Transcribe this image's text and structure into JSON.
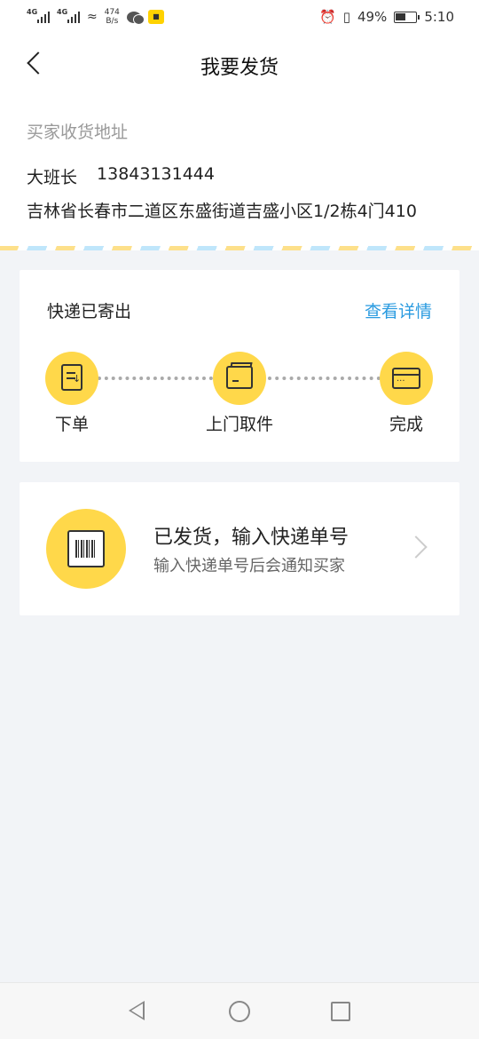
{
  "status_bar": {
    "signal1_label": "4G",
    "signal2_label": "4G",
    "net_speed_value": "474",
    "net_speed_unit": "B/s",
    "battery": "49%",
    "time": "5:10"
  },
  "header": {
    "title": "我要发货"
  },
  "address": {
    "label": "买家收货地址",
    "name": "大班长",
    "phone": "13843131444",
    "detail": "吉林省长春市二道区东盛街道吉盛小区1/2栋4门410"
  },
  "express": {
    "title": "快递已寄出",
    "detail_link": "查看详情",
    "steps": [
      {
        "label": "下单",
        "icon": "order-doc-icon"
      },
      {
        "label": "上门取件",
        "icon": "pickup-box-icon"
      },
      {
        "label": "完成",
        "icon": "complete-card-icon"
      }
    ]
  },
  "shipping": {
    "title": "已发货，输入快递单号",
    "subtitle": "输入快递单号后会通知买家",
    "icon": "barcode-icon"
  },
  "colors": {
    "accent_yellow": "#ffd84a",
    "link_blue": "#2a9be0",
    "background": "#f2f4f7"
  }
}
